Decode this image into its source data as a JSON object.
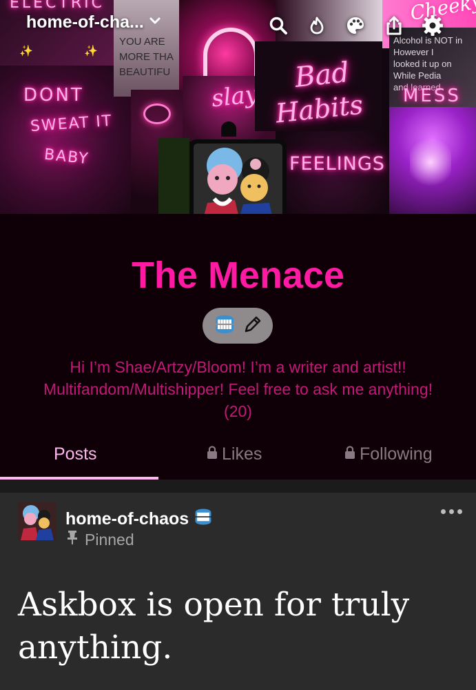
{
  "header": {
    "blog_name": "home-of-cha...",
    "switch_icon": "chevron-down-icon",
    "icons": [
      "search-icon",
      "flame-icon",
      "palette-icon",
      "share-icon",
      "gear-icon"
    ],
    "collage_text": {
      "electric": "ELECTRIC",
      "you_are": "YOU ARE",
      "more_tha": "MORE THA",
      "beautiful": "BEAUTIFU",
      "dont": "DONT",
      "sweat_it": "SWEAT IT",
      "baby": "BABY",
      "slay": "slay",
      "bad": "Bad",
      "habits": "Habits",
      "feelings": "FEELINGS",
      "mess": "MESS",
      "alcohol": "Alcohol is NOT in",
      "however": "However I",
      "looked": "looked it up on",
      "while": "While Pedia",
      "and_learned": "and learned",
      "cheeky": "Cheeky"
    }
  },
  "profile": {
    "title": "The Menace",
    "description": "Hi I’m Shae/Artzy/Bloom! I’m a writer and artist!! Multifandom/Multishipper! Feel free to ask me anything! (20)",
    "edit_icons": [
      "teeth-emoji-icon",
      "pencil-icon"
    ]
  },
  "tabs": [
    {
      "label": "Posts",
      "locked": false,
      "active": true
    },
    {
      "label": "Likes",
      "locked": true,
      "active": false
    },
    {
      "label": "Following",
      "locked": true,
      "active": false
    }
  ],
  "post": {
    "author": "home-of-chaos",
    "pinned_label": "Pinned",
    "body": "Askbox is open for truly anything."
  },
  "colors": {
    "accent": "#ff1aa3",
    "description": "#c5197a",
    "active_tab": "#ffb6ef",
    "inactive_tab": "#8a7883",
    "post_bg": "#2b2b2b",
    "profile_bg": "#0e0006"
  }
}
